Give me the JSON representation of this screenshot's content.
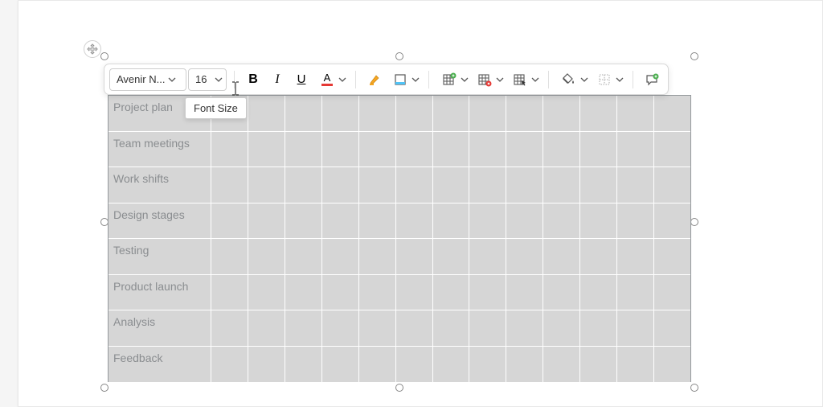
{
  "toolbar": {
    "font_name": "Avenir N...",
    "font_size": "16",
    "tooltip": "Font Size",
    "bold": "B",
    "italic": "I",
    "underline": "U",
    "font_color_letter": "A"
  },
  "table": {
    "rows": [
      "Project plan",
      "Team meetings",
      "Work shifts",
      "Design stages",
      "Testing",
      "Product launch",
      "Analysis",
      "Feedback"
    ],
    "extra_columns": 13
  }
}
